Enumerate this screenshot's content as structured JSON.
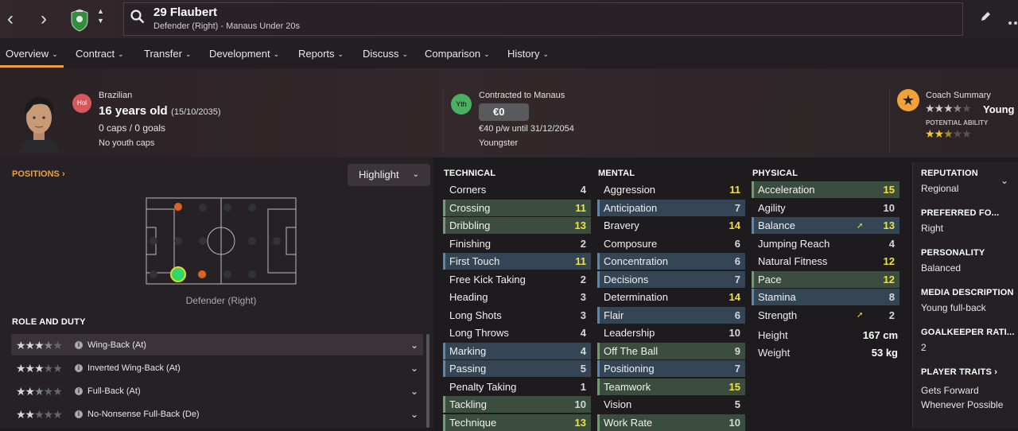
{
  "header": {
    "player_name": "29 Flaubert",
    "player_subtitle": "Defender (Right) - Manaus Under 20s"
  },
  "tabs": [
    {
      "label": "Overview"
    },
    {
      "label": "Contract"
    },
    {
      "label": "Transfer"
    },
    {
      "label": "Development"
    },
    {
      "label": "Reports"
    },
    {
      "label": "Discuss"
    },
    {
      "label": "Comparison"
    },
    {
      "label": "History"
    }
  ],
  "profile": {
    "badge": "Hol",
    "nationality": "Brazilian",
    "age": "16 years old",
    "dob": "(15/10/2035)",
    "caps": "0 caps / 0 goals",
    "youth_caps": "No youth caps"
  },
  "contract": {
    "badge": "Yth",
    "contracted_to": "Contracted to Manaus",
    "value": "€0",
    "wage": "€40 p/w until 31/12/2054",
    "status": "Youngster"
  },
  "coach": {
    "label": "Coach Summary",
    "summary": "Young p",
    "potential_label": "POTENTIAL ABILITY",
    "current_stars": 3.5,
    "potential_stars": 2.5
  },
  "positions": {
    "title": "POSITIONS",
    "highlight_label": "Highlight",
    "position_caption": "Defender (Right)"
  },
  "role_section": {
    "title": "ROLE AND DUTY",
    "roles": [
      {
        "name": "Wing-Back (At)",
        "stars": 3.5
      },
      {
        "name": "Inverted Wing-Back (At)",
        "stars": 3
      },
      {
        "name": "Full-Back (At)",
        "stars": 2.5
      },
      {
        "name": "No-Nonsense Full-Back (De)",
        "stars": 2
      }
    ]
  },
  "attributes": {
    "technical_title": "TECHNICAL",
    "mental_title": "MENTAL",
    "physical_title": "PHYSICAL",
    "technical": [
      {
        "name": "Corners",
        "value": "4",
        "hl": ""
      },
      {
        "name": "Crossing",
        "value": "11",
        "hl": "green"
      },
      {
        "name": "Dribbling",
        "value": "13",
        "hl": "green"
      },
      {
        "name": "Finishing",
        "value": "2",
        "hl": ""
      },
      {
        "name": "First Touch",
        "value": "11",
        "hl": "blue"
      },
      {
        "name": "Free Kick Taking",
        "value": "2",
        "hl": ""
      },
      {
        "name": "Heading",
        "value": "3",
        "hl": ""
      },
      {
        "name": "Long Shots",
        "value": "3",
        "hl": ""
      },
      {
        "name": "Long Throws",
        "value": "4",
        "hl": ""
      },
      {
        "name": "Marking",
        "value": "4",
        "hl": "blue"
      },
      {
        "name": "Passing",
        "value": "5",
        "hl": "blue"
      },
      {
        "name": "Penalty Taking",
        "value": "1",
        "hl": ""
      },
      {
        "name": "Tackling",
        "value": "10",
        "hl": "green"
      },
      {
        "name": "Technique",
        "value": "13",
        "hl": "green"
      }
    ],
    "mental": [
      {
        "name": "Aggression",
        "value": "11",
        "hl": ""
      },
      {
        "name": "Anticipation",
        "value": "7",
        "hl": "blue"
      },
      {
        "name": "Bravery",
        "value": "14",
        "hl": ""
      },
      {
        "name": "Composure",
        "value": "6",
        "hl": ""
      },
      {
        "name": "Concentration",
        "value": "6",
        "hl": "blue"
      },
      {
        "name": "Decisions",
        "value": "7",
        "hl": "blue"
      },
      {
        "name": "Determination",
        "value": "14",
        "hl": ""
      },
      {
        "name": "Flair",
        "value": "6",
        "hl": "blue"
      },
      {
        "name": "Leadership",
        "value": "10",
        "hl": ""
      },
      {
        "name": "Off The Ball",
        "value": "9",
        "hl": "green"
      },
      {
        "name": "Positioning",
        "value": "7",
        "hl": "blue"
      },
      {
        "name": "Teamwork",
        "value": "15",
        "hl": "green"
      },
      {
        "name": "Vision",
        "value": "5",
        "hl": ""
      },
      {
        "name": "Work Rate",
        "value": "10",
        "hl": "green"
      }
    ],
    "physical": [
      {
        "name": "Acceleration",
        "value": "15",
        "hl": "green"
      },
      {
        "name": "Agility",
        "value": "10",
        "hl": ""
      },
      {
        "name": "Balance",
        "value": "13",
        "hl": "blue"
      },
      {
        "name": "Jumping Reach",
        "value": "4",
        "hl": ""
      },
      {
        "name": "Natural Fitness",
        "value": "12",
        "hl": ""
      },
      {
        "name": "Pace",
        "value": "12",
        "hl": "green"
      },
      {
        "name": "Stamina",
        "value": "8",
        "hl": "blue"
      },
      {
        "name": "Strength",
        "value": "2",
        "hl": ""
      }
    ],
    "height_label": "Height",
    "height_value": "167 cm",
    "weight_label": "Weight",
    "weight_value": "53 kg"
  },
  "side": {
    "reputation_title": "REPUTATION",
    "reputation_value": "Regional",
    "pref_foot_title": "PREFERRED FO...",
    "pref_foot_value": "Right",
    "personality_title": "PERSONALITY",
    "personality_value": "Balanced",
    "media_title": "MEDIA DESCRIPTION",
    "media_value": "Young full-back",
    "gk_title": "GOALKEEPER RATI...",
    "gk_value": "2",
    "traits_title": "PLAYER TRAITS",
    "trait_1": "Gets Forward",
    "trait_2": "Whenever Possible"
  },
  "colors": {
    "accent": "#f0a13a",
    "highlight_yellow": "#f2e23a",
    "green_row": "#3b4d3e",
    "blue_row": "#344556"
  }
}
